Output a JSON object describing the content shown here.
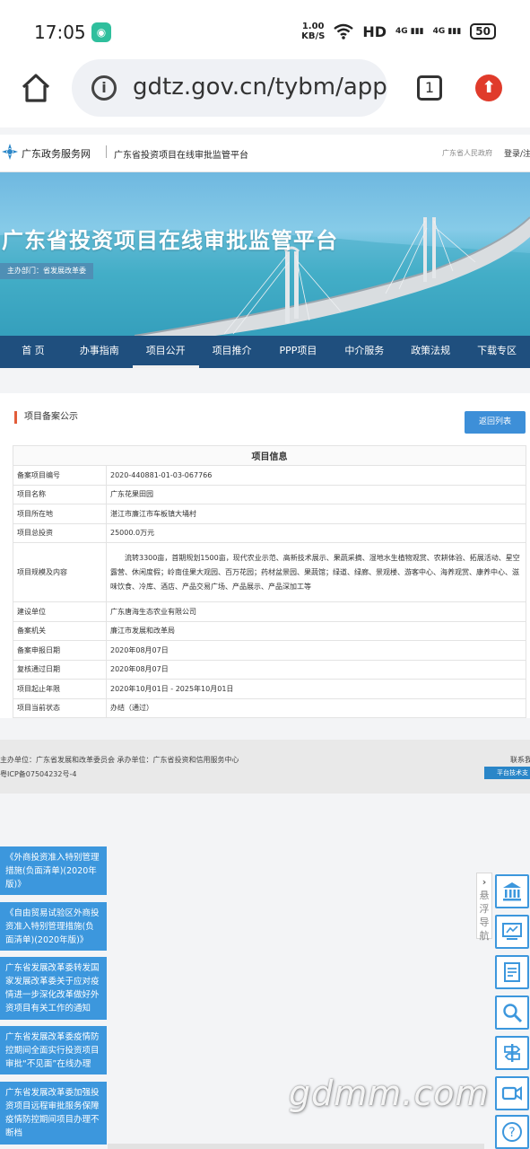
{
  "status_bar": {
    "time": "17:05",
    "net_speed_value": "1.00",
    "net_speed_unit": "KB/S",
    "hd": "HD",
    "sig1": "4G",
    "sig2": "4G",
    "battery": "50"
  },
  "browser": {
    "url": "gdtz.gov.cn/tybm/apply",
    "tab_count": "1"
  },
  "site_header": {
    "name": "广东政务服务网",
    "subtitle": "广东省投资项目在线审批监管平台",
    "gov_link": "广东省人民政府",
    "login": "登录/注"
  },
  "banner": {
    "title": "广东省投资项目在线审批监管平台",
    "host": "主办部门：省发展改革委"
  },
  "nav": [
    "首 页",
    "办事指南",
    "项目公开",
    "项目推介",
    "PPP项目",
    "中介服务",
    "政策法规",
    "下载专区"
  ],
  "section": {
    "title": "项目备案公示",
    "back_button": "返回列表"
  },
  "table": {
    "header": "项目信息",
    "rows": [
      {
        "label": "备案项目编号",
        "value": "2020-440881-01-03-067766"
      },
      {
        "label": "项目名称",
        "value": "广东花果田园"
      },
      {
        "label": "项目所在地",
        "value": "湛江市廉江市车板镇大埇村"
      },
      {
        "label": "项目总投资",
        "value": "25000.0万元"
      },
      {
        "label": "项目规模及内容",
        "value": "流转3300亩，首期规划1500亩，现代农业示范、高新技术展示、果蔬采摘、湿地水生植物观赏、农耕体验、拓展活动、星空露营、休闲度假；岭南佳果大观园、百万花园；药材盆景园、果蔬馆；绿道、绿廊、景观楼、游客中心、海养观赏、康养中心、滋味饮食、冷库、酒店、产品交易广场、产品展示、产品深加工等"
      },
      {
        "label": "建设单位",
        "value": "广东唐海生态农业有限公司"
      },
      {
        "label": "备案机关",
        "value": "廉江市发展和改革局"
      },
      {
        "label": "备案申报日期",
        "value": "2020年08月07日"
      },
      {
        "label": "复核通过日期",
        "value": "2020年08月07日"
      },
      {
        "label": "项目起止年限",
        "value": "2020年10月01日 - 2025年10月01日"
      },
      {
        "label": "项目当前状态",
        "value": "办结（通过）"
      }
    ]
  },
  "footer": {
    "host": "主办单位：广东省发展和改革委员会    承办单位：广东省投资和信用服务中心",
    "icp": "粤ICP备07504232号-4",
    "contact": "联系我",
    "badge": "平台技术支"
  },
  "news": [
    "《外商投资准入特别管理措施(负面清单)(2020年版)》",
    "《自由贸易试验区外商投资准入特别管理措施(负面清单)(2020年版)》",
    "广东省发展改革委转发国家发展改革委关于应对疫情进一步深化改革做好外资项目有关工作的通知",
    "广东省发展改革委疫情防控期间全面实行投资项目审批“不见面”在线办理",
    "广东省发展改革委加强投资项目远程审批服务保障疫情防控期间项目办理不断档"
  ],
  "guide_tab": [
    "悬",
    "浮",
    "导",
    "航"
  ],
  "tool_icons": [
    "bank-icon",
    "screen-icon",
    "document-icon",
    "search-icon",
    "signpost-icon",
    "video-icon",
    "help-icon"
  ],
  "watermark": "gdmm.com",
  "colors": {
    "nav_bg": "#1f4f7e",
    "button_blue": "#3d8fd8",
    "accent_red": "#e25d3a",
    "news_blue": "#3c97dd"
  }
}
